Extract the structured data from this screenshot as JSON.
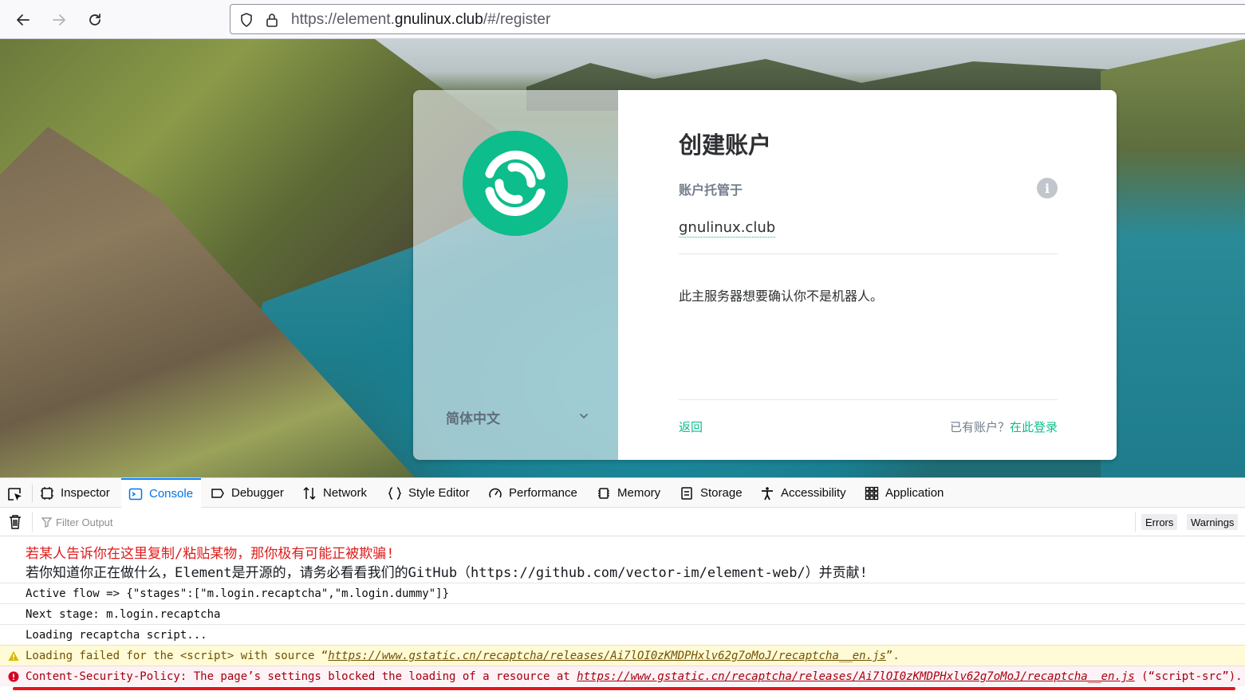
{
  "browser": {
    "url_prefix": "https://element.",
    "url_domain": "gnulinux.club",
    "url_suffix": "/#/register"
  },
  "auth": {
    "title": "创建账户",
    "hosted_label": "账户托管于",
    "server_name": "gnulinux.club",
    "captcha_message": "此主服务器想要确认你不是机器人。",
    "back_link": "返回",
    "have_account": "已有账户？",
    "login_link": "在此登录",
    "language": "简体中文",
    "brand_color": "#0dbd8b"
  },
  "devtools": {
    "tabs": [
      {
        "label": "Inspector",
        "icon": "inspector-icon"
      },
      {
        "label": "Console",
        "icon": "console-icon"
      },
      {
        "label": "Debugger",
        "icon": "debugger-icon"
      },
      {
        "label": "Network",
        "icon": "network-icon"
      },
      {
        "label": "Style Editor",
        "icon": "style-editor-icon"
      },
      {
        "label": "Performance",
        "icon": "performance-icon"
      },
      {
        "label": "Memory",
        "icon": "memory-icon"
      },
      {
        "label": "Storage",
        "icon": "storage-icon"
      },
      {
        "label": "Accessibility",
        "icon": "accessibility-icon"
      },
      {
        "label": "Application",
        "icon": "application-icon"
      }
    ],
    "active_tab": "Console",
    "filter_placeholder": "Filter Output",
    "filter_chips": [
      "Errors",
      "Warnings"
    ]
  },
  "console": {
    "warning_line_1": "若某人告诉你在这里复制/粘贴某物，那你极有可能正被欺骗!",
    "warning_line_2": "若你知道你正在做什么，Element是开源的，请务必看看我们的GitHub（https://github.com/vector-im/element-web/）并贡献!",
    "logs": [
      "Active flow => {\"stages\":[\"m.login.recaptcha\",\"m.login.dummy\"]}",
      "Next stage: m.login.recaptcha",
      "Loading recaptcha script..."
    ],
    "warning_prefix": "Loading failed for the <script> with source “",
    "warning_url": "https://www.gstatic.cn/recaptcha/releases/Ai7lOI0zKMDPHxlv62g7oMoJ/recaptcha__en.js",
    "warning_suffix": "”.",
    "error_prefix": "Content-Security-Policy: The page’s settings blocked the loading of a resource at ",
    "error_url": "https://www.gstatic.cn/recaptcha/releases/Ai7lOI0zKMDPHxlv62g7oMoJ/recaptcha__en.js",
    "error_suffix": " (“script-src”)."
  }
}
